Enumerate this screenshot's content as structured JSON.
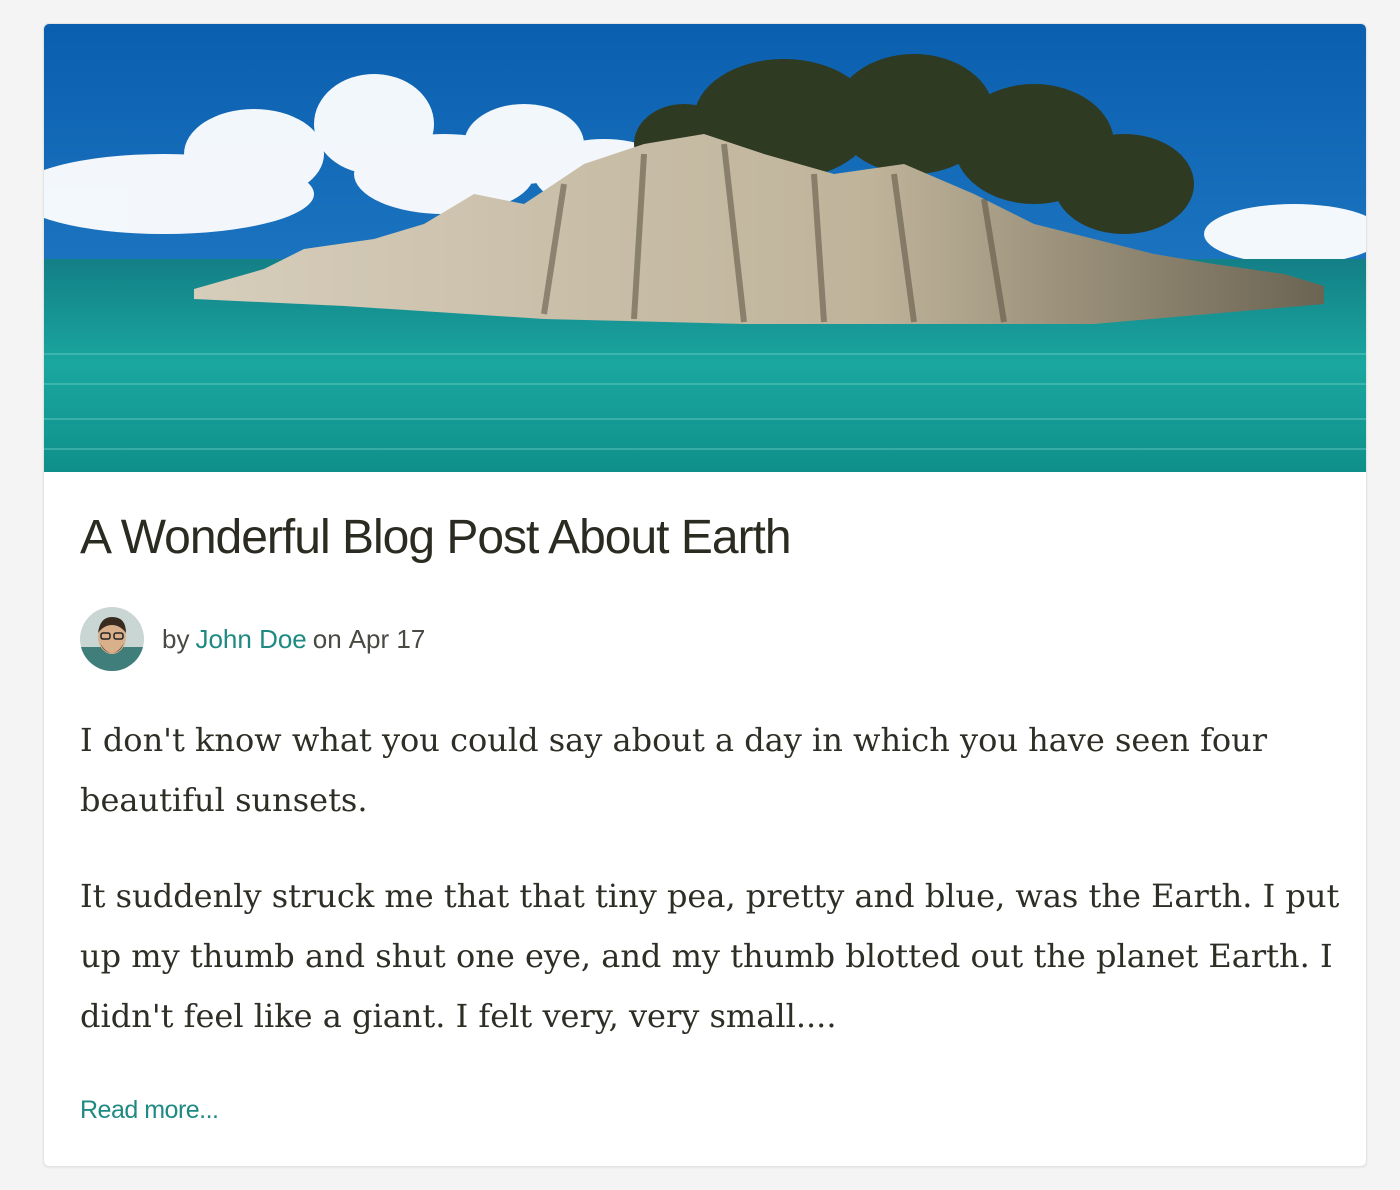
{
  "post": {
    "title": "A Wonderful Blog Post About Earth",
    "byline": {
      "prefix": "by",
      "author": "John Doe",
      "date_prefix": "on",
      "date": "Apr 17"
    },
    "paragraphs": [
      "I don't know what you could say about a day in which you have seen four beautiful sunsets.",
      "It suddenly struck me that that tiny pea, pretty and blue, was the Earth. I put up my thumb and shut one eye, and my thumb blotted out the planet Earth. I didn't feel like a giant. I felt very, very small...."
    ],
    "read_more": "Read more..."
  },
  "colors": {
    "accent": "#1f8a83",
    "title": "#2b2b22",
    "body_text": "#2e2e26"
  }
}
